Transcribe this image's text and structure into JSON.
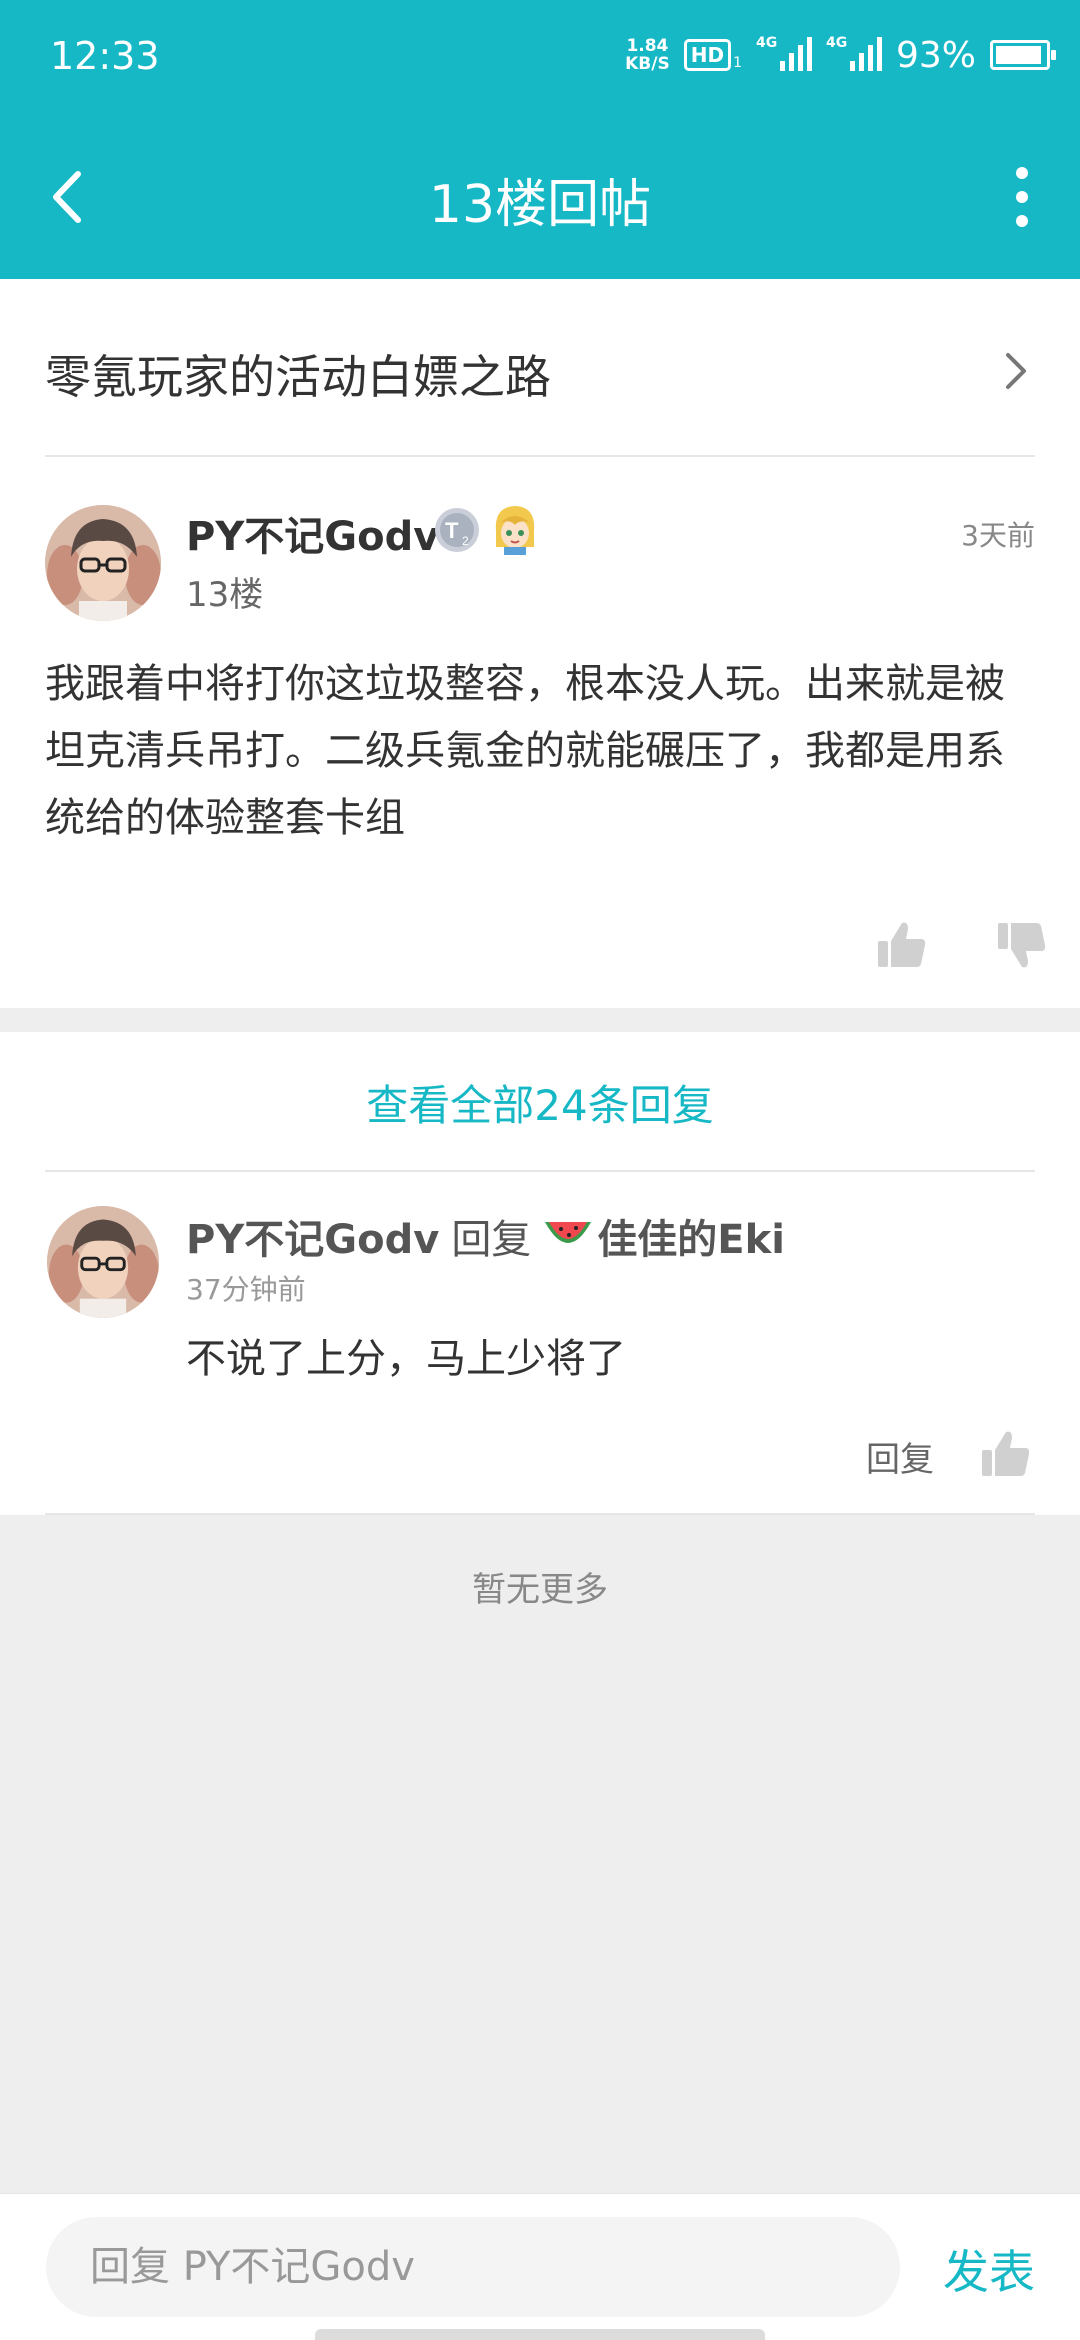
{
  "status": {
    "time": "12:33",
    "speed_value": "1.84",
    "speed_unit": "KB/S",
    "hd": "HD",
    "hd_sub": "1",
    "net1": "4G",
    "net2": "4G",
    "battery": "93%",
    "battery_level": 0.93
  },
  "header": {
    "title": "13楼回帖",
    "back_icon": "chevron-left-icon",
    "more_icon": "more-vertical-icon"
  },
  "topic": {
    "title": "零氪玩家的活动白嫖之路"
  },
  "post": {
    "author": "PY不记Godv",
    "floor": "13楼",
    "time": "3天前",
    "body": "我跟着中将打你这垃圾整容，根本没人玩。出来就是被坦克清兵吊打。二级兵氪金的就能碾压了，我都是用系统给的体验整套卡组",
    "badges": [
      "level-badge-icon",
      "girl-avatar-badge-icon"
    ]
  },
  "replies_section": {
    "view_all": "查看全部24条回复",
    "items": [
      {
        "author": "PY不记Godv",
        "verb": "回复",
        "target": "佳佳的Eki",
        "time": "37分钟前",
        "body": "不说了上分，马上少将了",
        "reply_label": "回复"
      }
    ],
    "no_more": "暂无更多"
  },
  "composer": {
    "placeholder": "回复 PY不记Godv",
    "send_label": "发表"
  },
  "colors": {
    "accent": "#16b8c6",
    "background": "#eeeeee"
  }
}
